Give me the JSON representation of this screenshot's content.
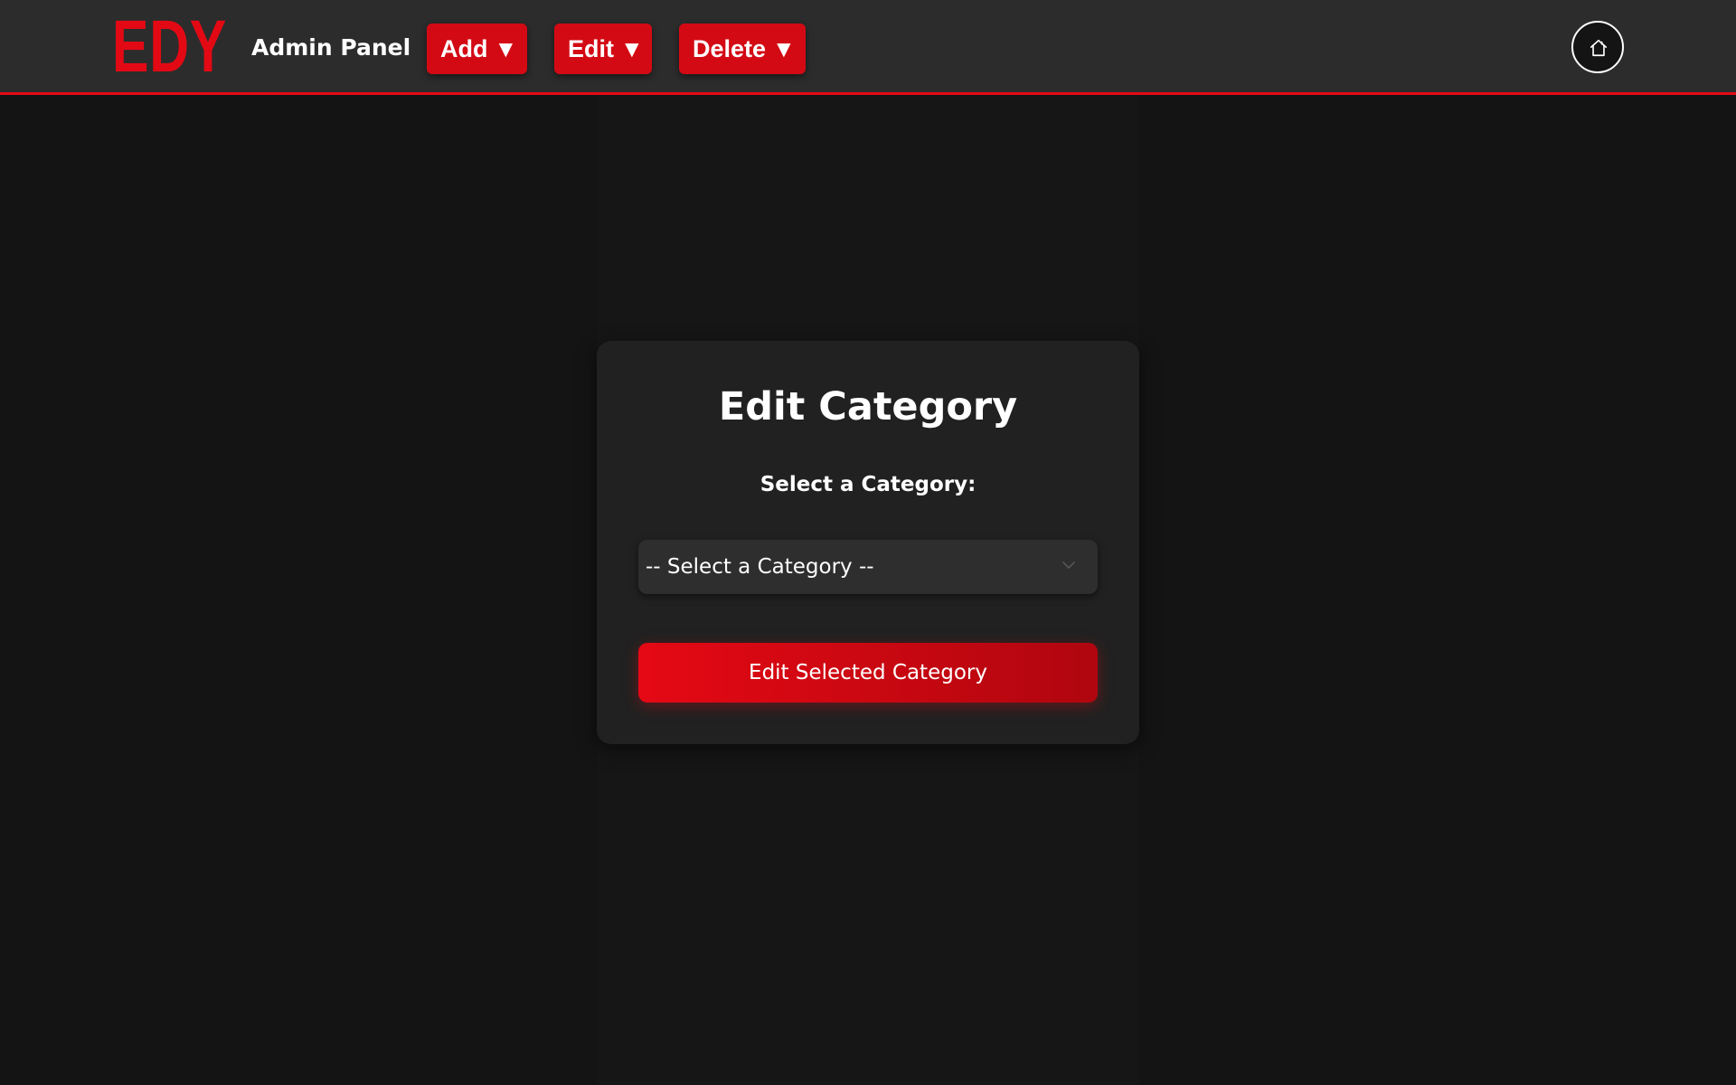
{
  "header": {
    "logo": "EDY",
    "panel_title": "Admin Panel",
    "menus": [
      {
        "label": "Add",
        "caret": "▼"
      },
      {
        "label": "Edit",
        "caret": "▼"
      },
      {
        "label": "Delete",
        "caret": "▼"
      }
    ],
    "home_icon": "home-icon"
  },
  "card": {
    "title": "Edit Category",
    "select_label": "Select a Category:",
    "select_placeholder": "-- Select a Category --",
    "submit_label": "Edit Selected Category"
  },
  "colors": {
    "accent": "#e30914",
    "header_bg": "#2c2c2c",
    "page_bg": "#141414",
    "card_bg": "#212121",
    "select_bg": "#2e2e2e"
  }
}
